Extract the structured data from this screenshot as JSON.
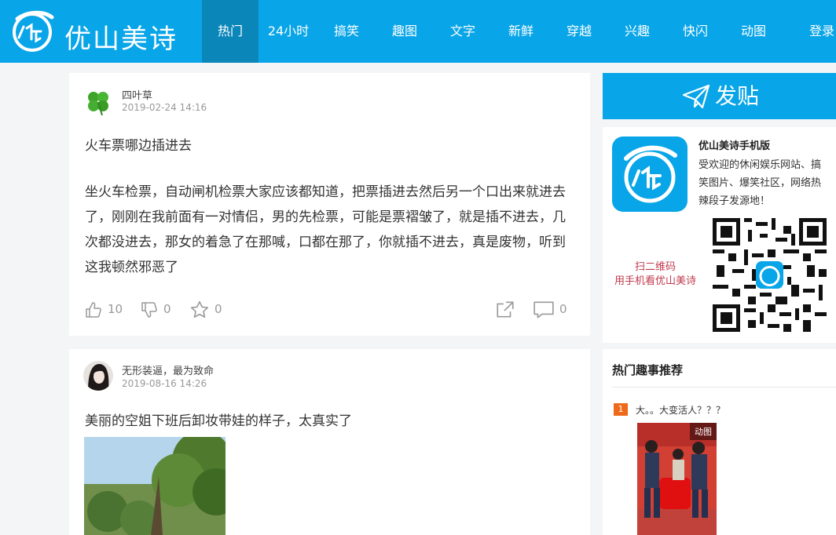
{
  "brand": {
    "name": "优山美诗",
    "colors": {
      "primary": "#08a5e8",
      "active": "#0a86b9",
      "badge": "#ee6a1a"
    }
  },
  "nav": {
    "items": [
      {
        "label": "热门",
        "active": true
      },
      {
        "label": "24小时"
      },
      {
        "label": "搞笑"
      },
      {
        "label": "趣图"
      },
      {
        "label": "文字"
      },
      {
        "label": "新鲜"
      },
      {
        "label": "穿越"
      },
      {
        "label": "兴趣"
      },
      {
        "label": "快闪"
      },
      {
        "label": "动图"
      }
    ],
    "login": "登录"
  },
  "posts": [
    {
      "author": "四叶草",
      "date": "2019-02-24 14:16",
      "avatar_icon": "four-leaf-clover-icon",
      "title": "火车票哪边插进去",
      "body": "坐火车检票，自动闸机检票大家应该都知道，把票插进去然后另一个口出来就进去了，刚刚在我前面有一对情侣，男的先检票，可能是票褶皱了，就是插不进去，几次都没进去，那女的着急了在那喊，口都在那了，你就插不进去，真是废物，听到这我顿然邪恶了",
      "likes": "10",
      "dislikes": "0",
      "favorites": "0",
      "comments": "0"
    },
    {
      "author": "无形装逼，最为致命",
      "date": "2019-08-16 14:26",
      "avatar_icon": "user-photo",
      "title": "美丽的空姐下班后卸妆带娃的样子，太真实了"
    }
  ],
  "sidebar": {
    "post_button": "发贴",
    "app": {
      "title": "优山美诗手机版",
      "desc": "受欢迎的休闲娱乐网站、搞笑图片、爆笑社区，网络热辣段子发源地！",
      "qr_hint_line1": "扫二维码",
      "qr_hint_line2": "用手机看优山美诗"
    },
    "hot": {
      "title": "热门趣事推荐",
      "items": [
        {
          "rank": "1",
          "title": "大。。大变活人？？？",
          "badge": "动图"
        }
      ]
    }
  }
}
